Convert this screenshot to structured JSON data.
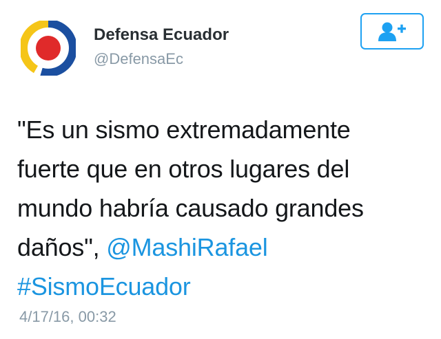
{
  "author": {
    "name": "Defensa Ecuador",
    "handle": "@DefensaEc",
    "avatar_icon": "defensa-ecuador-logo",
    "avatar_colors": [
      "#f5c518",
      "#1b4fa0",
      "#e02a2a"
    ]
  },
  "follow_button": {
    "icon": "add-user-icon",
    "color": "#1da1f2"
  },
  "tweet": {
    "text_lines": [
      "\"Es un sismo extremadamente",
      "fuerte que en otros lugares del",
      "mundo habría causado grandes",
      "daños\", "
    ],
    "mention": "@MashiRafael",
    "hashtag": "#SismoEcuador",
    "link_color": "#1b95e0"
  },
  "timestamp": "4/17/16, 00:32"
}
